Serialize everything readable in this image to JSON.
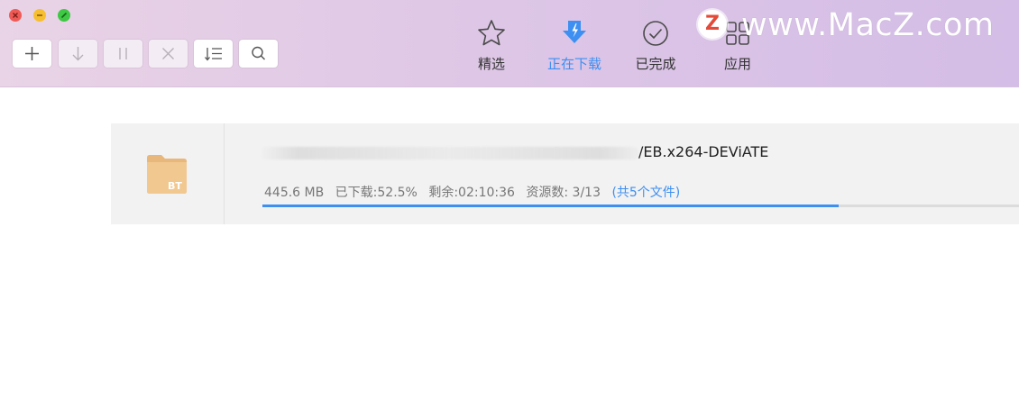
{
  "toolbar": {
    "buttons": [
      {
        "name": "add",
        "icon": "plus-icon",
        "enabled": true
      },
      {
        "name": "resume",
        "icon": "arrow-down-icon",
        "enabled": false
      },
      {
        "name": "pause",
        "icon": "pause-icon",
        "enabled": false
      },
      {
        "name": "delete",
        "icon": "close-icon",
        "enabled": false
      },
      {
        "name": "sort",
        "icon": "sort-list-icon",
        "enabled": true
      },
      {
        "name": "search",
        "icon": "search-icon",
        "enabled": true
      }
    ],
    "tabs": [
      {
        "label": "精选",
        "icon": "star-icon",
        "active": false
      },
      {
        "label": "正在下载",
        "icon": "download-icon",
        "active": true
      },
      {
        "label": "已完成",
        "icon": "check-circle-icon",
        "active": false
      },
      {
        "label": "应用",
        "icon": "apps-grid-icon",
        "active": false
      }
    ],
    "accent_color": "#3d8ff2"
  },
  "watermark": {
    "logo_letter": "Z",
    "text": "www.MacZ.com"
  },
  "task": {
    "icon_label": "BT",
    "name_visible": "/EB.x264-DEViATE",
    "size": "445.6 MB",
    "downloaded": "已下载:52.5%",
    "remaining": "剩余:02:10:36",
    "sources": "资源数: 3/13",
    "files": "(共5个文件)",
    "progress": 0.525
  }
}
